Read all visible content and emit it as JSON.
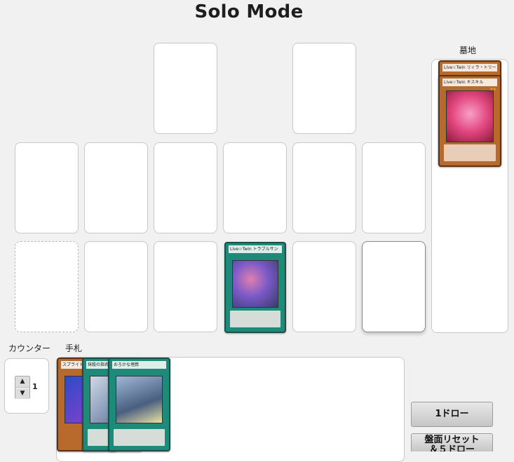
{
  "page": {
    "title": "Solo Mode"
  },
  "labels": {
    "graveyard": "墓地",
    "counter": "カウンター",
    "hand": "手札"
  },
  "counter": {
    "value": "1",
    "up_symbol": "▲",
    "down_symbol": "▼"
  },
  "buttons": {
    "draw_one": "1ドロー",
    "reset_draw": "盤面リセット\n＆５ドロー"
  },
  "field": {
    "spell_on_field": {
      "name": "Live☆Twin トラブルサン"
    }
  },
  "graveyard": {
    "cards": [
      {
        "name": "Live☆Twin リィラ・トリート"
      },
      {
        "name": "Live☆Twin キスキル"
      }
    ]
  },
  "hand": {
    "cards": [
      {
        "name": "スプライト"
      },
      {
        "name": "抹殺の指名者"
      },
      {
        "name": "おろかな埋葬"
      }
    ]
  },
  "colors": {
    "background": "#f1f1f1",
    "spell_card": "#1d8a7a",
    "effect_monster": "#b86a2c"
  }
}
